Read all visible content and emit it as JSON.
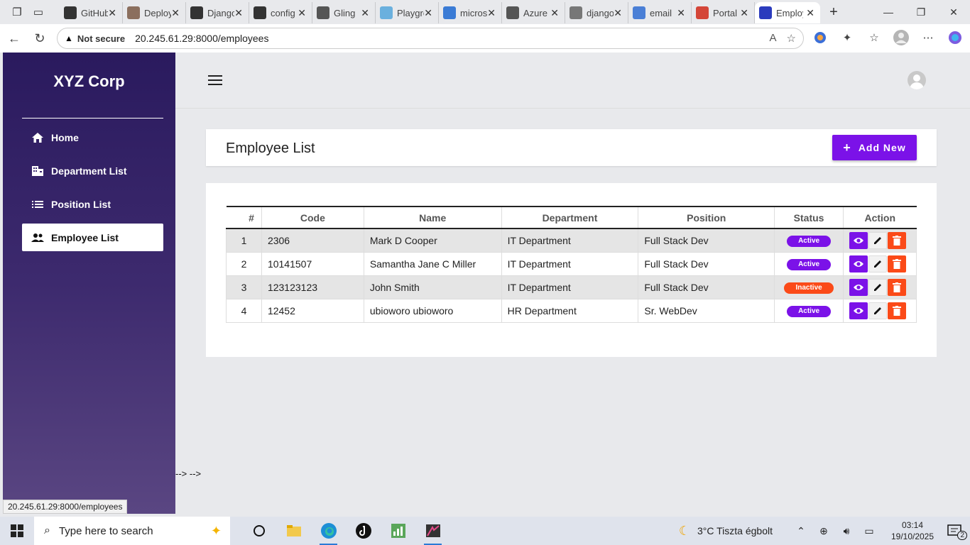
{
  "browser": {
    "tabs": [
      {
        "title": "GitHub",
        "icon": "github-icon",
        "color": "#333333"
      },
      {
        "title": "Deploy",
        "icon": "image-icon",
        "color": "#8b6f5e"
      },
      {
        "title": "Django",
        "icon": "github-icon",
        "color": "#333333"
      },
      {
        "title": "config",
        "icon": "github-icon",
        "color": "#333333"
      },
      {
        "title": "Gling",
        "icon": "gling-icon",
        "color": "#555555"
      },
      {
        "title": "Playground",
        "icon": "cloud-icon",
        "color": "#6ab0de"
      },
      {
        "title": "microsoft",
        "icon": "azure-icon",
        "color": "#3a7bd5"
      },
      {
        "title": "Azure",
        "icon": "openai-icon",
        "color": "#555555"
      },
      {
        "title": "django",
        "icon": "page-icon",
        "color": "#777777"
      },
      {
        "title": "email",
        "icon": "search-icon",
        "color": "#4a7fd6"
      },
      {
        "title": "Portal",
        "icon": "gmail-icon",
        "color": "#d44638"
      },
      {
        "title": "Employees",
        "icon": "bootstrap-icon",
        "color": "#2b3bbd"
      }
    ],
    "not_secure": "Not secure",
    "url": "20.245.61.29:8000/employees"
  },
  "sidebar": {
    "brand": "XYZ Corp",
    "items": [
      {
        "label": "Home",
        "icon": "home-icon"
      },
      {
        "label": "Department List",
        "icon": "building-icon"
      },
      {
        "label": "Position List",
        "icon": "list-icon"
      },
      {
        "label": "Employee List",
        "icon": "people-icon"
      }
    ]
  },
  "page": {
    "title": "Employee List",
    "add_button": "Add New",
    "stray_text": "--> -->"
  },
  "table": {
    "headers": [
      "#",
      "Code",
      "Name",
      "Department",
      "Position",
      "Status",
      "Action"
    ],
    "rows": [
      {
        "num": "1",
        "code": "2306",
        "name": "Mark D Cooper",
        "department": "IT Department",
        "position": "Full Stack Dev",
        "status": "Active"
      },
      {
        "num": "2",
        "code": "10141507",
        "name": "Samantha Jane C Miller",
        "department": "IT Department",
        "position": "Full Stack Dev",
        "status": "Active"
      },
      {
        "num": "3",
        "code": "123123123",
        "name": "John Smith",
        "department": "IT Department",
        "position": "Full Stack Dev",
        "status": "Inactive"
      },
      {
        "num": "4",
        "code": "12452",
        "name": "ubioworo ubioworo",
        "department": "HR Department",
        "position": "Sr. WebDev",
        "status": "Active"
      }
    ]
  },
  "status_bar": {
    "url": "20.245.61.29:8000/employees"
  },
  "taskbar": {
    "search_placeholder": "Type here to search",
    "weather": "3°C  Tiszta égbolt",
    "time": "03:14",
    "date": "19/10/2025",
    "notifications": "2"
  },
  "colors": {
    "accent": "#7b12e8",
    "danger": "#fb4a18",
    "sidebar_top": "#2a1a5e",
    "sidebar_bottom": "#5a4682"
  }
}
